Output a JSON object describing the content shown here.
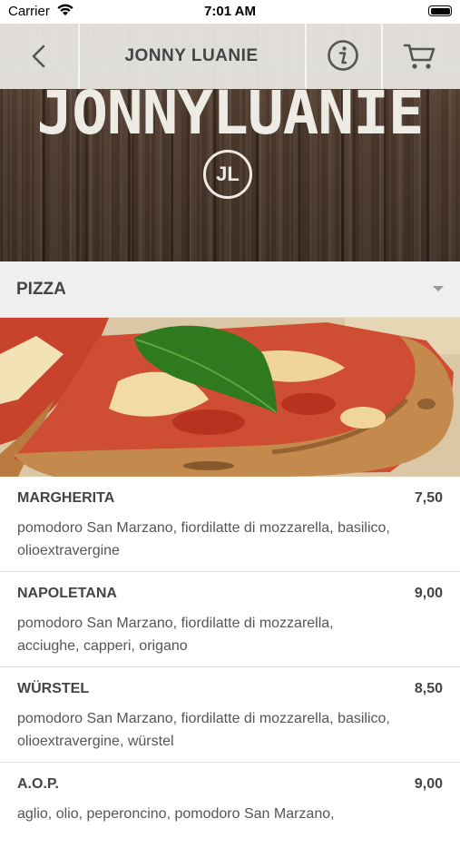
{
  "status_bar": {
    "carrier": "Carrier",
    "time": "7:01 AM"
  },
  "nav": {
    "title": "JONNY LUANIE",
    "back_icon": "chevron-left-icon",
    "info_icon": "info-icon",
    "cart_icon": "cart-icon"
  },
  "hero": {
    "brand_word": "JONNYLUANIE",
    "badge": "JL"
  },
  "category": {
    "title": "PIZZA"
  },
  "menu": {
    "items": [
      {
        "name": "MARGHERITA",
        "price": "7,50",
        "description": "pomodoro San Marzano, fiordilatte di mozzarella, basilico, olioextravergine"
      },
      {
        "name": "NAPOLETANA",
        "price": "9,00",
        "description": "pomodoro San Marzano, fiordilatte di mozzarella, acciughe, capperi, origano"
      },
      {
        "name": "WÜRSTEL",
        "price": "8,50",
        "description": "pomodoro San Marzano, fiordilatte di mozzarella, basilico, olioextravergine, würstel"
      },
      {
        "name": "A.O.P.",
        "price": "9,00",
        "description": "aglio, olio, peperoncino, pomodoro San Marzano,"
      }
    ]
  },
  "colors": {
    "nav_background": "#eceae6",
    "wood_dark": "#3d2d24",
    "category_background": "#efefef"
  }
}
